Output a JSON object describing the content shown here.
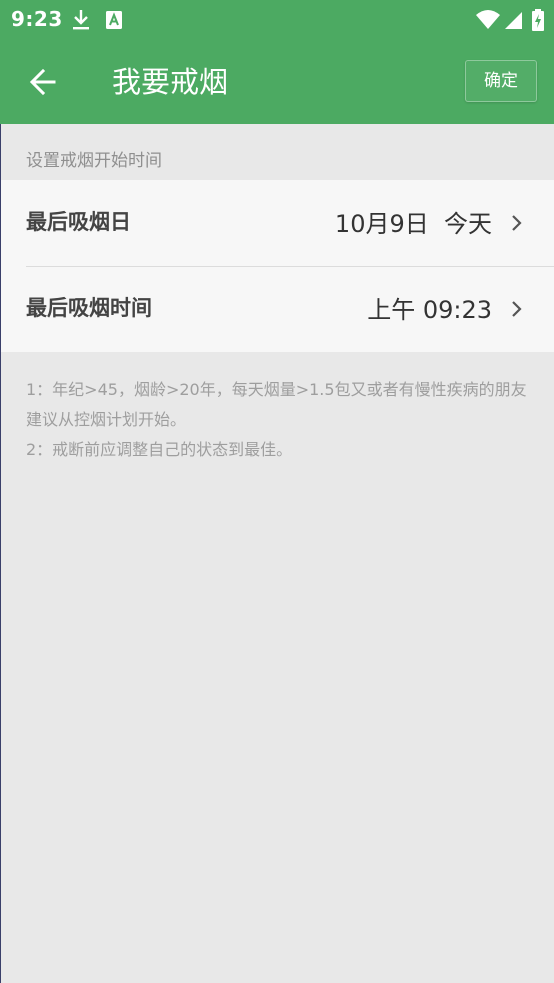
{
  "status_bar": {
    "time": "9:23",
    "icons": [
      "download-icon",
      "font-a-icon",
      "wifi-icon",
      "signal-icon",
      "battery-charging-icon"
    ],
    "bg_color": "#4caa62"
  },
  "app_bar": {
    "back_icon": "arrow-left-icon",
    "title": "我要戒烟",
    "confirm_label": "确定",
    "bg_color": "#4caa62"
  },
  "section": {
    "header": "设置戒烟开始时间"
  },
  "rows": [
    {
      "label": "最后吸烟日",
      "value": "10月9日  今天",
      "icon": "chevron-right-icon"
    },
    {
      "label": "最后吸烟时间",
      "value": "上午 09:23",
      "icon": "chevron-right-icon"
    }
  ],
  "notes": [
    "1：年纪>45，烟龄>20年，每天烟量>1.5包又或者有慢性疾病的朋友建议从控烟计划开始。",
    "2：戒断前应调整自己的状态到最佳。"
  ]
}
